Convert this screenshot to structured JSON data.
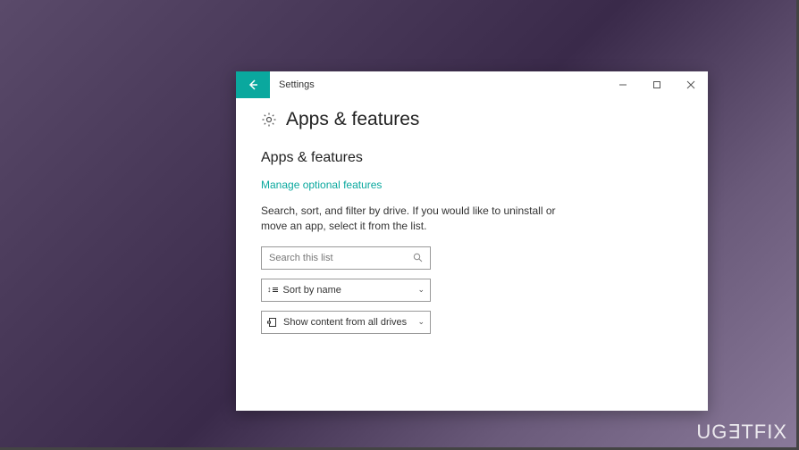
{
  "window": {
    "title": "Settings"
  },
  "page": {
    "title": "Apps & features",
    "section_title": "Apps & features",
    "link": "Manage optional features",
    "description": "Search, sort, and filter by drive. If you would like to uninstall or move an app, select it from the list."
  },
  "search": {
    "placeholder": "Search this list"
  },
  "sort": {
    "label": "Sort by name"
  },
  "filter": {
    "label": "Show content from all drives"
  },
  "watermark": "UG∃TFIX"
}
